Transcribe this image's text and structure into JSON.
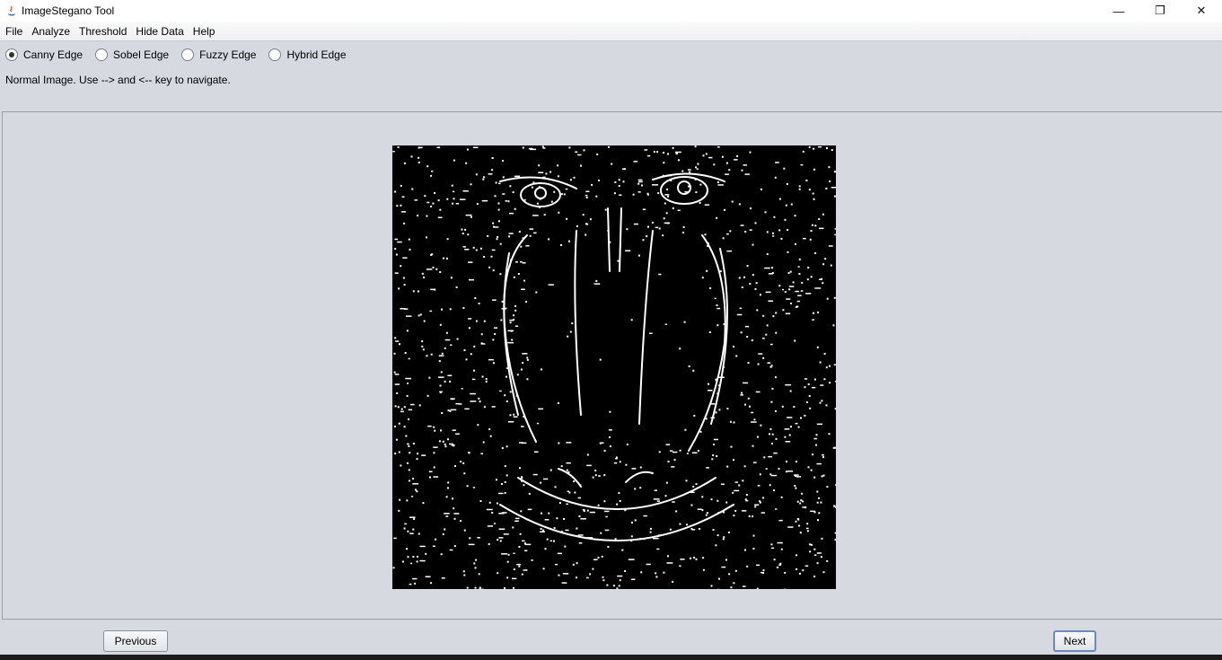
{
  "window": {
    "title": "ImageStegano Tool"
  },
  "menu": [
    "File",
    "Analyze",
    "Threshold",
    "Hide Data",
    "Help"
  ],
  "radios": [
    {
      "label": "Canny Edge",
      "checked": true
    },
    {
      "label": "Sobel Edge",
      "checked": false
    },
    {
      "label": "Fuzzy Edge",
      "checked": false
    },
    {
      "label": "Hybrid Edge",
      "checked": false
    }
  ],
  "status": {
    "text": "Normal Image. Use --> and <-- key to navigate."
  },
  "buttons": {
    "previous": "Previous",
    "next": "Next"
  },
  "colors": {
    "background": "#d6d9df",
    "image_bg": "#000000",
    "edges": "#ffffff"
  }
}
